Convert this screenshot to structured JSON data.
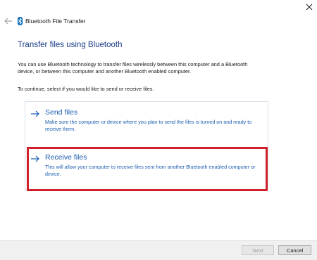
{
  "window": {
    "title": "Bluetooth File Transfer"
  },
  "heading": "Transfer files using Bluetooth",
  "description": "You can use Bluetooth technology to transfer files wirelessly between this computer and a Bluetooth device, or between this computer and another Bluetooth enabled computer.",
  "prompt": "To continue, select if you would like to send or receive files.",
  "options": [
    {
      "title": "Send files",
      "subtitle": "Make sure the computer or device where you plan to send the files is turned on and ready to receive them."
    },
    {
      "title": "Receive files",
      "subtitle": "This will allow your computer to receive files sent from another Bluetooth enabled computer or device."
    }
  ],
  "buttons": {
    "next": "Next",
    "cancel": "Cancel"
  },
  "colors": {
    "link": "#1a5db0",
    "heading": "#1a3a8a",
    "highlight": "#d0202a",
    "bluetooth": "#0063b1"
  },
  "icons": {
    "back": "back-arrow-icon",
    "bluetooth": "bluetooth-icon",
    "close": "close-icon",
    "option_arrow": "right-arrow-icon"
  }
}
